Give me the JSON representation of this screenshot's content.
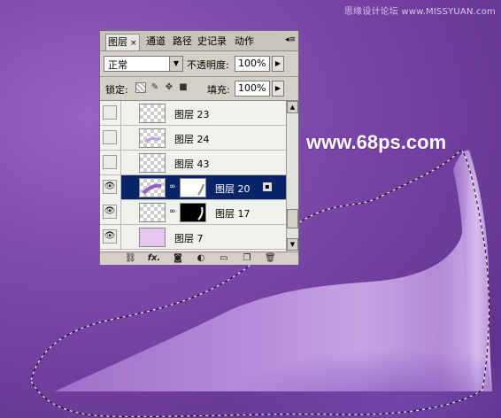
{
  "watermarks": {
    "top_right": "思缘设计论坛 www.MISSYUAN.com",
    "center": "www.68ps.com"
  },
  "colors": {
    "background": "#7f4aad",
    "shape_fill": "#b58ad8",
    "panel_bg": "#d4d0c8",
    "selected_row": "#0a246a"
  },
  "panel": {
    "tabs": [
      {
        "label": "图层",
        "active": true
      },
      {
        "label": "通道"
      },
      {
        "label": "路径"
      },
      {
        "label": "史记录"
      },
      {
        "label": "动作"
      }
    ],
    "close_glyph": "×",
    "menu_icon": "panel-menu-icon",
    "blend_mode": {
      "value": "正常"
    },
    "opacity": {
      "label": "不透明度:",
      "value": "100%"
    },
    "lock": {
      "label": "锁定:",
      "icons": [
        "lock-transparent-icon",
        "lock-paint-icon",
        "lock-move-icon",
        "lock-all-icon"
      ]
    },
    "fill": {
      "label": "填充:",
      "value": "100%"
    },
    "layers": [
      {
        "name": "图层 23",
        "visible": false,
        "selected": false,
        "has_mask": false
      },
      {
        "name": "图层 24",
        "visible": false,
        "selected": false,
        "has_mask": false
      },
      {
        "name": "图层 43",
        "visible": false,
        "selected": false,
        "has_mask": false
      },
      {
        "name": "图层 20",
        "visible": true,
        "selected": true,
        "has_mask": true,
        "mask": "white"
      },
      {
        "name": "图层 17",
        "visible": true,
        "selected": false,
        "has_mask": true,
        "mask": "black"
      },
      {
        "name": "图层 7",
        "visible": true,
        "selected": false,
        "has_mask": false
      }
    ],
    "footer_icons": [
      "link-layers-icon",
      "fx-icon",
      "add-mask-icon",
      "adjustment-layer-icon",
      "new-group-icon",
      "new-layer-icon",
      "trash-icon"
    ],
    "fx_label": "fx."
  }
}
